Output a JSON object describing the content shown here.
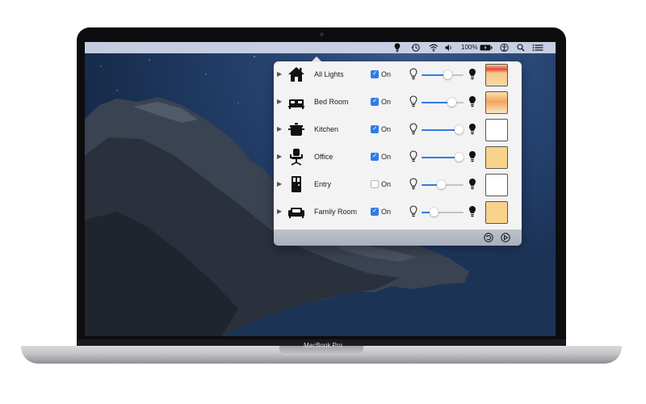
{
  "menubar": {
    "battery_percent": "100%",
    "icons": [
      "lightbulb-icon",
      "time-machine-icon",
      "wifi-icon",
      "volume-icon",
      "battery-icon",
      "accessibility-icon",
      "search-icon",
      "control-center-icon"
    ]
  },
  "device": {
    "brand_label": "MacBook Pro"
  },
  "rooms": [
    {
      "name": "All Lights",
      "icon": "house-icon",
      "checked": true,
      "check_label": "On",
      "brightness": 0.63,
      "color": "#f6c98a"
    },
    {
      "name": "Bed Room",
      "icon": "bed-icon",
      "checked": true,
      "check_label": "On",
      "brightness": 0.72,
      "color": "#f5c27c"
    },
    {
      "name": "Kitchen",
      "icon": "pot-icon",
      "checked": true,
      "check_label": "On",
      "brightness": 0.9,
      "color": "#ffffff"
    },
    {
      "name": "Office",
      "icon": "chair-icon",
      "checked": true,
      "check_label": "On",
      "brightness": 0.9,
      "color": "#f9d28c"
    },
    {
      "name": "Entry",
      "icon": "door-icon",
      "checked": false,
      "check_label": "On",
      "brightness": 0.47,
      "color": "#ffffff"
    },
    {
      "name": "Family Room",
      "icon": "sofa-icon",
      "checked": true,
      "check_label": "On",
      "brightness": 0.3,
      "color": "#f9d28c"
    }
  ],
  "colors": {
    "accent": "#2f7ce8",
    "popover_bg": "#f3f3f3"
  }
}
